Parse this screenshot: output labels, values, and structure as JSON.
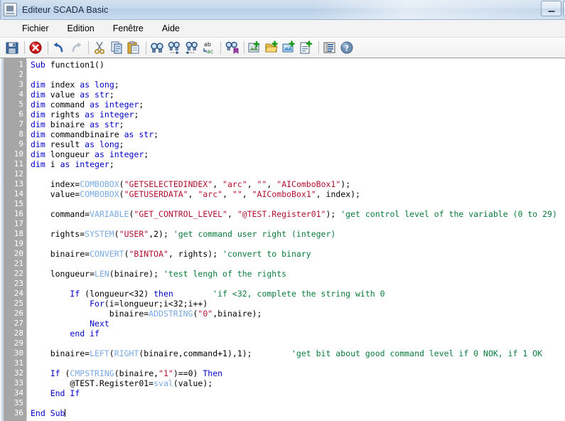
{
  "window": {
    "title": "Editeur SCADA Basic",
    "app_icon": "application-icon",
    "buttons": [
      {
        "name": "minimize",
        "glyph": "minimize-icon"
      },
      {
        "name": "maximize",
        "glyph": "maximize-icon"
      }
    ]
  },
  "menubar": {
    "items": [
      {
        "label": "Fichier",
        "name": "menu-fichier"
      },
      {
        "label": "Edition",
        "name": "menu-edition"
      },
      {
        "label": "Fenêtre",
        "name": "menu-fenetre"
      },
      {
        "label": "Aide",
        "name": "menu-aide"
      }
    ]
  },
  "toolbar": {
    "items": [
      {
        "name": "save-icon",
        "type": "icon"
      },
      {
        "name": "separator",
        "type": "sep"
      },
      {
        "name": "delete-icon",
        "type": "icon"
      },
      {
        "name": "separator",
        "type": "sep"
      },
      {
        "name": "undo-icon",
        "type": "icon"
      },
      {
        "name": "redo-icon",
        "type": "icon"
      },
      {
        "name": "separator",
        "type": "sep"
      },
      {
        "name": "cut-icon",
        "type": "icon"
      },
      {
        "name": "copy-icon",
        "type": "icon"
      },
      {
        "name": "paste-icon",
        "type": "icon"
      },
      {
        "name": "separator",
        "type": "sep"
      },
      {
        "name": "find-icon",
        "type": "icon"
      },
      {
        "name": "find-next-icon",
        "type": "icon"
      },
      {
        "name": "find-previous-icon",
        "type": "icon"
      },
      {
        "name": "replace-icon",
        "type": "icon"
      },
      {
        "name": "separator",
        "type": "sep"
      },
      {
        "name": "find-bookmark-icon",
        "type": "icon"
      },
      {
        "name": "separator",
        "type": "sep"
      },
      {
        "name": "insert-variable-icon",
        "type": "icon"
      },
      {
        "name": "insert-folder-icon",
        "type": "icon"
      },
      {
        "name": "insert-image-icon",
        "type": "icon"
      },
      {
        "name": "insert-document-icon",
        "type": "icon"
      },
      {
        "name": "separator",
        "type": "sep"
      },
      {
        "name": "list-functions-icon",
        "type": "icon"
      },
      {
        "name": "help-icon",
        "type": "icon"
      }
    ]
  },
  "editor": {
    "total_lines": 36,
    "line_numbers": [
      1,
      2,
      3,
      4,
      5,
      6,
      7,
      8,
      9,
      10,
      11,
      12,
      13,
      14,
      15,
      16,
      17,
      18,
      19,
      20,
      21,
      22,
      23,
      24,
      25,
      26,
      27,
      28,
      29,
      30,
      31,
      32,
      33,
      34,
      35,
      36
    ],
    "lines": [
      {
        "n": 1,
        "tokens": [
          {
            "t": "Sub",
            "c": "kw"
          },
          {
            "t": " function1()",
            "c": ""
          }
        ]
      },
      {
        "n": 2,
        "tokens": []
      },
      {
        "n": 3,
        "tokens": [
          {
            "t": "dim",
            "c": "kw"
          },
          {
            "t": " index ",
            "c": ""
          },
          {
            "t": "as",
            "c": "kw"
          },
          {
            "t": " ",
            "c": ""
          },
          {
            "t": "long",
            "c": "kw"
          },
          {
            "t": ";",
            "c": ""
          }
        ]
      },
      {
        "n": 4,
        "tokens": [
          {
            "t": "dim",
            "c": "kw"
          },
          {
            "t": " value ",
            "c": ""
          },
          {
            "t": "as",
            "c": "kw"
          },
          {
            "t": " ",
            "c": ""
          },
          {
            "t": "str",
            "c": "kw"
          },
          {
            "t": ";",
            "c": ""
          }
        ]
      },
      {
        "n": 5,
        "tokens": [
          {
            "t": "dim",
            "c": "kw"
          },
          {
            "t": " command ",
            "c": ""
          },
          {
            "t": "as",
            "c": "kw"
          },
          {
            "t": " ",
            "c": ""
          },
          {
            "t": "integer",
            "c": "kw"
          },
          {
            "t": ";",
            "c": ""
          }
        ]
      },
      {
        "n": 6,
        "tokens": [
          {
            "t": "dim",
            "c": "kw"
          },
          {
            "t": " rights ",
            "c": ""
          },
          {
            "t": "as",
            "c": "kw"
          },
          {
            "t": " ",
            "c": ""
          },
          {
            "t": "integer",
            "c": "kw"
          },
          {
            "t": ";",
            "c": ""
          }
        ]
      },
      {
        "n": 7,
        "tokens": [
          {
            "t": "dim",
            "c": "kw"
          },
          {
            "t": " binaire ",
            "c": ""
          },
          {
            "t": "as",
            "c": "kw"
          },
          {
            "t": " ",
            "c": ""
          },
          {
            "t": "str",
            "c": "kw"
          },
          {
            "t": ";",
            "c": ""
          }
        ]
      },
      {
        "n": 8,
        "tokens": [
          {
            "t": "dim",
            "c": "kw"
          },
          {
            "t": " commandbinaire ",
            "c": ""
          },
          {
            "t": "as",
            "c": "kw"
          },
          {
            "t": " ",
            "c": ""
          },
          {
            "t": "str",
            "c": "kw"
          },
          {
            "t": ";",
            "c": ""
          }
        ]
      },
      {
        "n": 9,
        "tokens": [
          {
            "t": "dim",
            "c": "kw"
          },
          {
            "t": " result ",
            "c": ""
          },
          {
            "t": "as",
            "c": "kw"
          },
          {
            "t": " ",
            "c": ""
          },
          {
            "t": "long",
            "c": "kw"
          },
          {
            "t": ";",
            "c": ""
          }
        ]
      },
      {
        "n": 10,
        "tokens": [
          {
            "t": "dim",
            "c": "kw"
          },
          {
            "t": " longueur ",
            "c": ""
          },
          {
            "t": "as",
            "c": "kw"
          },
          {
            "t": " ",
            "c": ""
          },
          {
            "t": "integer",
            "c": "kw"
          },
          {
            "t": ";",
            "c": ""
          }
        ]
      },
      {
        "n": 11,
        "tokens": [
          {
            "t": "dim",
            "c": "kw"
          },
          {
            "t": " i ",
            "c": ""
          },
          {
            "t": "as",
            "c": "kw"
          },
          {
            "t": " ",
            "c": ""
          },
          {
            "t": "integer",
            "c": "kw"
          },
          {
            "t": ";",
            "c": ""
          }
        ]
      },
      {
        "n": 12,
        "tokens": []
      },
      {
        "n": 13,
        "tokens": [
          {
            "t": "    index=",
            "c": ""
          },
          {
            "t": "COMBOBOX",
            "c": "fn"
          },
          {
            "t": "(",
            "c": ""
          },
          {
            "t": "\"GETSELECTEDINDEX\"",
            "c": "str"
          },
          {
            "t": ", ",
            "c": ""
          },
          {
            "t": "\"arc\"",
            "c": "str"
          },
          {
            "t": ", ",
            "c": ""
          },
          {
            "t": "\"\"",
            "c": "str"
          },
          {
            "t": ", ",
            "c": ""
          },
          {
            "t": "\"AIComboBox1\"",
            "c": "str"
          },
          {
            "t": ");",
            "c": ""
          }
        ]
      },
      {
        "n": 14,
        "tokens": [
          {
            "t": "    value=",
            "c": ""
          },
          {
            "t": "COMBOBOX",
            "c": "fn"
          },
          {
            "t": "(",
            "c": ""
          },
          {
            "t": "\"GETUSERDATA\"",
            "c": "str"
          },
          {
            "t": ", ",
            "c": ""
          },
          {
            "t": "\"arc\"",
            "c": "str"
          },
          {
            "t": ", ",
            "c": ""
          },
          {
            "t": "\"\"",
            "c": "str"
          },
          {
            "t": ", ",
            "c": ""
          },
          {
            "t": "\"AIComboBox1\"",
            "c": "str"
          },
          {
            "t": ", index);",
            "c": ""
          }
        ]
      },
      {
        "n": 15,
        "tokens": []
      },
      {
        "n": 16,
        "tokens": [
          {
            "t": "    command=",
            "c": ""
          },
          {
            "t": "VARIABLE",
            "c": "fn"
          },
          {
            "t": "(",
            "c": ""
          },
          {
            "t": "\"GET_CONTROL_LEVEL\"",
            "c": "str"
          },
          {
            "t": ", ",
            "c": ""
          },
          {
            "t": "\"@TEST.Register01\"",
            "c": "str"
          },
          {
            "t": "); ",
            "c": ""
          },
          {
            "t": "'get control level of the variable (0 to 29)",
            "c": "cmt"
          }
        ]
      },
      {
        "n": 17,
        "tokens": []
      },
      {
        "n": 18,
        "tokens": [
          {
            "t": "    rights=",
            "c": ""
          },
          {
            "t": "SYSTEM",
            "c": "fn"
          },
          {
            "t": "(",
            "c": ""
          },
          {
            "t": "\"USER\"",
            "c": "str"
          },
          {
            "t": ",2); ",
            "c": ""
          },
          {
            "t": "'get command user right (integer)",
            "c": "cmt"
          }
        ]
      },
      {
        "n": 19,
        "tokens": []
      },
      {
        "n": 20,
        "tokens": [
          {
            "t": "    binaire=",
            "c": ""
          },
          {
            "t": "CONVERT",
            "c": "fn"
          },
          {
            "t": "(",
            "c": ""
          },
          {
            "t": "\"BINTOA\"",
            "c": "str"
          },
          {
            "t": ", rights); ",
            "c": ""
          },
          {
            "t": "'convert to binary",
            "c": "cmt"
          }
        ]
      },
      {
        "n": 21,
        "tokens": []
      },
      {
        "n": 22,
        "tokens": [
          {
            "t": "    longueur=",
            "c": ""
          },
          {
            "t": "LEN",
            "c": "fn"
          },
          {
            "t": "(binaire); ",
            "c": ""
          },
          {
            "t": "'test lengh of the rights",
            "c": "cmt"
          }
        ]
      },
      {
        "n": 23,
        "tokens": []
      },
      {
        "n": 24,
        "tokens": [
          {
            "t": "        ",
            "c": ""
          },
          {
            "t": "If",
            "c": "kw"
          },
          {
            "t": " (longueur<32) ",
            "c": ""
          },
          {
            "t": "then",
            "c": "kw"
          },
          {
            "t": "        ",
            "c": ""
          },
          {
            "t": "'if <32, complete the string with 0",
            "c": "cmt"
          }
        ]
      },
      {
        "n": 25,
        "tokens": [
          {
            "t": "            ",
            "c": ""
          },
          {
            "t": "For",
            "c": "kw"
          },
          {
            "t": "(i=longueur;i<32;i++)",
            "c": ""
          }
        ]
      },
      {
        "n": 26,
        "tokens": [
          {
            "t": "                binaire=",
            "c": ""
          },
          {
            "t": "ADDSTRING",
            "c": "fn"
          },
          {
            "t": "(",
            "c": ""
          },
          {
            "t": "\"0\"",
            "c": "str"
          },
          {
            "t": ",binaire);",
            "c": ""
          }
        ]
      },
      {
        "n": 27,
        "tokens": [
          {
            "t": "            ",
            "c": ""
          },
          {
            "t": "Next",
            "c": "kw"
          }
        ]
      },
      {
        "n": 28,
        "tokens": [
          {
            "t": "        ",
            "c": ""
          },
          {
            "t": "end if",
            "c": "kw"
          }
        ]
      },
      {
        "n": 29,
        "tokens": []
      },
      {
        "n": 30,
        "tokens": [
          {
            "t": "    binaire=",
            "c": ""
          },
          {
            "t": "LEFT",
            "c": "fn"
          },
          {
            "t": "(",
            "c": ""
          },
          {
            "t": "RIGHT",
            "c": "fn"
          },
          {
            "t": "(binaire,command+1),1);        ",
            "c": ""
          },
          {
            "t": "'get bit about good command level if 0 NOK, if 1 OK",
            "c": "cmt"
          }
        ]
      },
      {
        "n": 31,
        "tokens": []
      },
      {
        "n": 32,
        "tokens": [
          {
            "t": "    ",
            "c": ""
          },
          {
            "t": "If",
            "c": "kw"
          },
          {
            "t": " (",
            "c": ""
          },
          {
            "t": "CMPSTRING",
            "c": "fn"
          },
          {
            "t": "(binaire,",
            "c": ""
          },
          {
            "t": "\"1\"",
            "c": "str"
          },
          {
            "t": ")==0) ",
            "c": ""
          },
          {
            "t": "Then",
            "c": "kw"
          }
        ]
      },
      {
        "n": 33,
        "tokens": [
          {
            "t": "        @TEST.Register01=",
            "c": ""
          },
          {
            "t": "sval",
            "c": "fn"
          },
          {
            "t": "(value);",
            "c": ""
          }
        ]
      },
      {
        "n": 34,
        "tokens": [
          {
            "t": "    ",
            "c": ""
          },
          {
            "t": "End If",
            "c": "kw"
          }
        ]
      },
      {
        "n": 35,
        "tokens": []
      },
      {
        "n": 36,
        "tokens": [
          {
            "t": "End Sub",
            "c": "kw"
          }
        ],
        "caret": true
      }
    ],
    "colors": {
      "keyword": "#0000c8",
      "function": "#7aaae0",
      "string": "#b01030",
      "comment": "#0a7a3c",
      "plain": "#000000",
      "gutter_bg": "#a6a6a6",
      "gutter_fg": "#ffffff",
      "background": "#ffffff"
    }
  }
}
